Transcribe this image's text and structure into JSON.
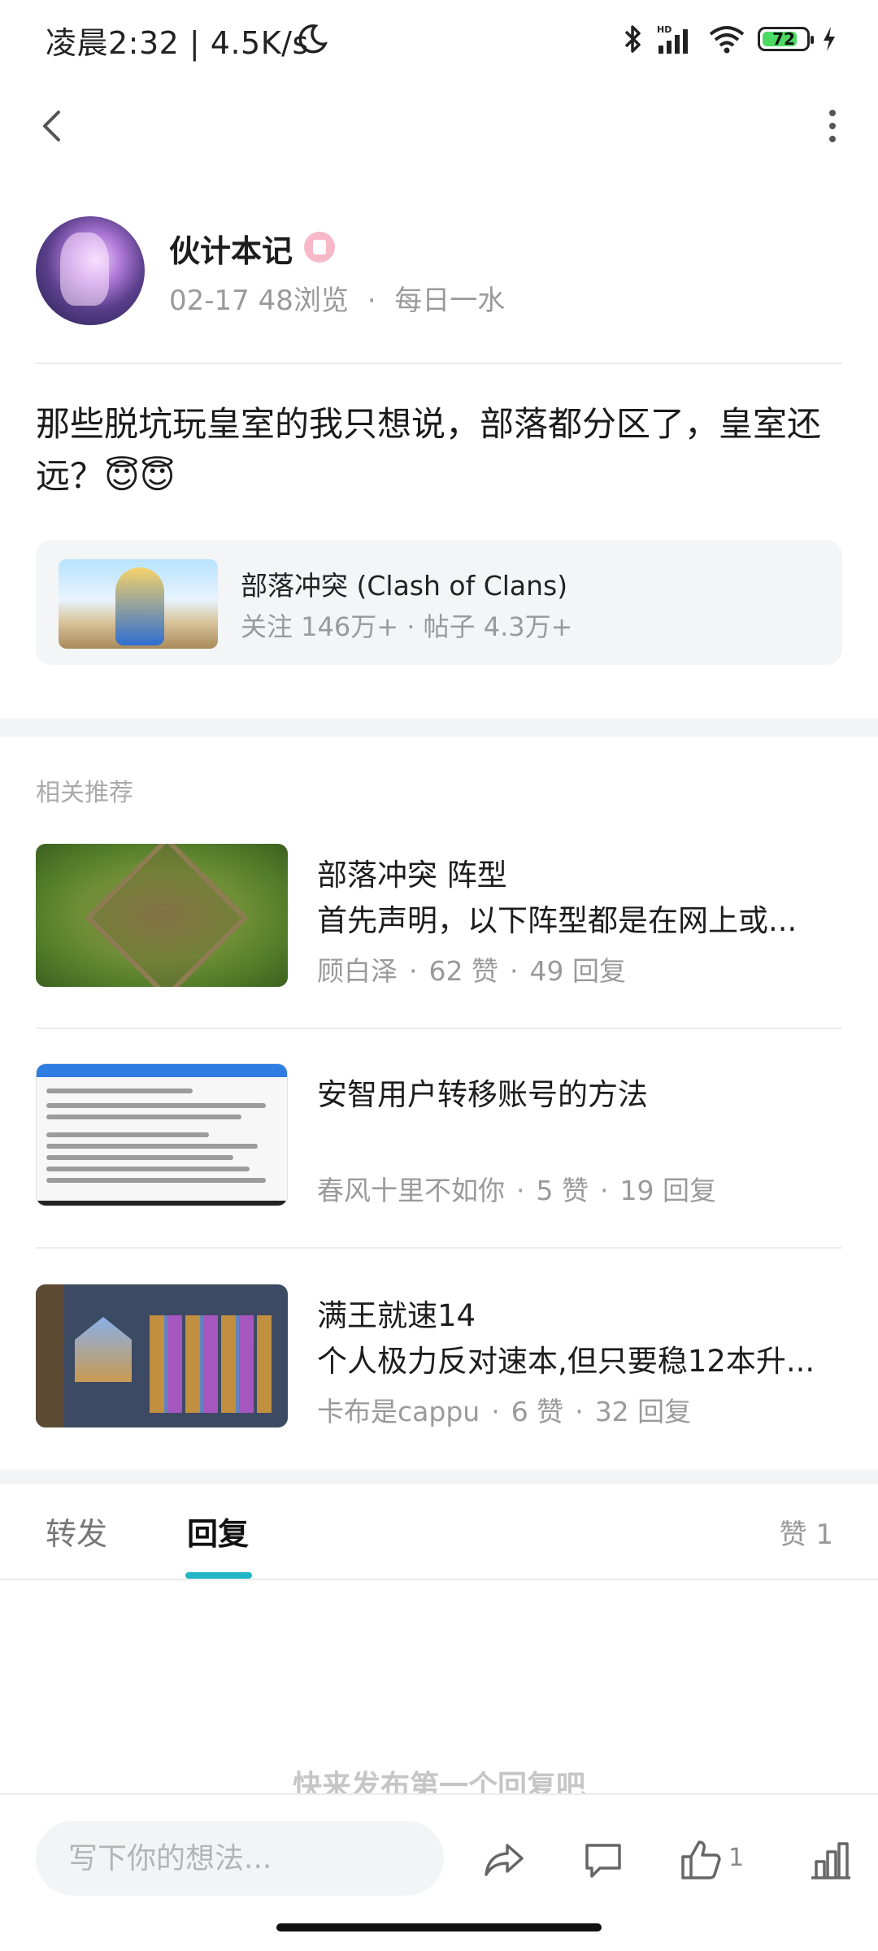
{
  "status_bar": {
    "time": "凌晨2:32 | 4.5K/s",
    "battery": "72"
  },
  "author": {
    "name": "伙计本记",
    "date": "02-17",
    "views": "48浏览",
    "separator": "·",
    "category": "每日一水"
  },
  "post": {
    "text": "那些脱坑玩皇室的我只想说，部落都分区了，皇室还远？😇😇"
  },
  "game_card": {
    "title": "部落冲突 (Clash of Clans)",
    "stats": "关注 146万+ · 帖子 4.3万+"
  },
  "recommendations": {
    "heading": "相关推荐",
    "items": [
      {
        "title": "部落冲突 阵型",
        "excerpt": "首先声明，以下阵型都是在网上或...",
        "author": "顾白泽",
        "likes": "62 赞",
        "replies": "49 回复"
      },
      {
        "title": "安智用户转移账号的方法",
        "excerpt": "",
        "author": "春风十里不如你",
        "likes": "5 赞",
        "replies": "19 回复"
      },
      {
        "title": "满王就速14",
        "excerpt": "个人极力反对速本,但只要稳12本升...",
        "author": "卡布是cappu",
        "likes": "6 赞",
        "replies": "32 回复"
      }
    ],
    "dot": "·"
  },
  "tabs": {
    "forward": "转发",
    "reply": "回复",
    "likes": "赞 1",
    "active": "reply"
  },
  "empty_hint": "快来发布第一个回复吧",
  "bottom_bar": {
    "placeholder": "写下你的想法...",
    "like_count": "1"
  },
  "colors": {
    "accent": "#22b5c8",
    "muted_text": "#9a9a9a",
    "battery_fill": "#4cd964"
  },
  "icons": [
    "moon-icon",
    "bluetooth-icon",
    "signal-icon",
    "wifi-icon",
    "battery-icon",
    "charging-icon",
    "back-icon",
    "more-icon",
    "share-icon",
    "comment-icon",
    "thumbs-up-icon",
    "stats-icon"
  ]
}
